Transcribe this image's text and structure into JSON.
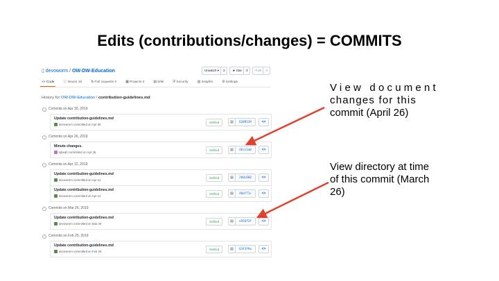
{
  "slide_title": "Edits (contributions/changes) = COMMITS",
  "repo": {
    "owner": "devoworm",
    "separator": "/",
    "name": "OW-DW-Education",
    "watch_label": "Unwatch ▾",
    "watch_count": "3",
    "star_label": "★ Star",
    "star_count": "3",
    "fork_label": "Fork",
    "fork_count": "4"
  },
  "tabs": [
    {
      "label": "<> Code"
    },
    {
      "label": "ⓘ Issues 16"
    },
    {
      "label": "⇅ Pull requests 0"
    },
    {
      "label": "▦ Projects 0"
    },
    {
      "label": "▤ Wiki"
    },
    {
      "label": "⛨ Security"
    },
    {
      "label": "▥ Insights"
    },
    {
      "label": "⚙ Settings"
    }
  ],
  "history": {
    "prefix": "History for ",
    "repo": "OW-DW-Education",
    "sep": " / ",
    "file": "contribution-guidelines.md"
  },
  "groups": [
    {
      "header": "Commits on Apr 30, 2019",
      "commits": [
        {
          "message": "Update contribution-guidelines.md",
          "meta": "devoworm committed on Apr 30",
          "avatar": "green",
          "verified": "Verified",
          "sha": "6289139"
        }
      ]
    },
    {
      "header": "Commits on Apr 26, 2019",
      "commits": [
        {
          "message": "Minute changes.",
          "meta": "sjbeah committed on Apr 26",
          "avatar": "pink",
          "verified": "Verified",
          "sha": "d6cc1a0"
        }
      ]
    },
    {
      "header": "Commits on Apr 12, 2019",
      "commits": [
        {
          "message": "Update contribution-guidelines.md",
          "meta": "devoworm committed on Apr 12",
          "avatar": "green",
          "verified": "Verified",
          "sha": "2b0c860"
        },
        {
          "message": "Update contribution-guidelines.md",
          "meta": "devoworm committed on Apr 12",
          "avatar": "green",
          "verified": "Verified",
          "sha": "4bbf71c"
        }
      ]
    },
    {
      "header": "Commits on Mar 26, 2019",
      "commits": [
        {
          "message": "Update contribution-guidelines.md",
          "meta": "devoworm committed on Mar 26",
          "avatar": "green",
          "verified": "Verified",
          "sha": "e593f3f"
        }
      ]
    },
    {
      "header": "Commits on Feb 25, 2019",
      "commits": [
        {
          "message": "Update contribution-guidelines.md",
          "meta": "devoworm committed on Feb 25",
          "avatar": "green",
          "verified": "Verified",
          "sha": "63f3f9a"
        }
      ]
    }
  ],
  "annotations": {
    "view_doc": [
      "View document",
      "changes for this",
      "commit (April 26)"
    ],
    "view_dir": [
      "View directory at time",
      "of this commit (March",
      "26)"
    ]
  },
  "colors": {
    "arrow": "#e0402c",
    "link": "#0366d6",
    "verified": "#28a745"
  }
}
